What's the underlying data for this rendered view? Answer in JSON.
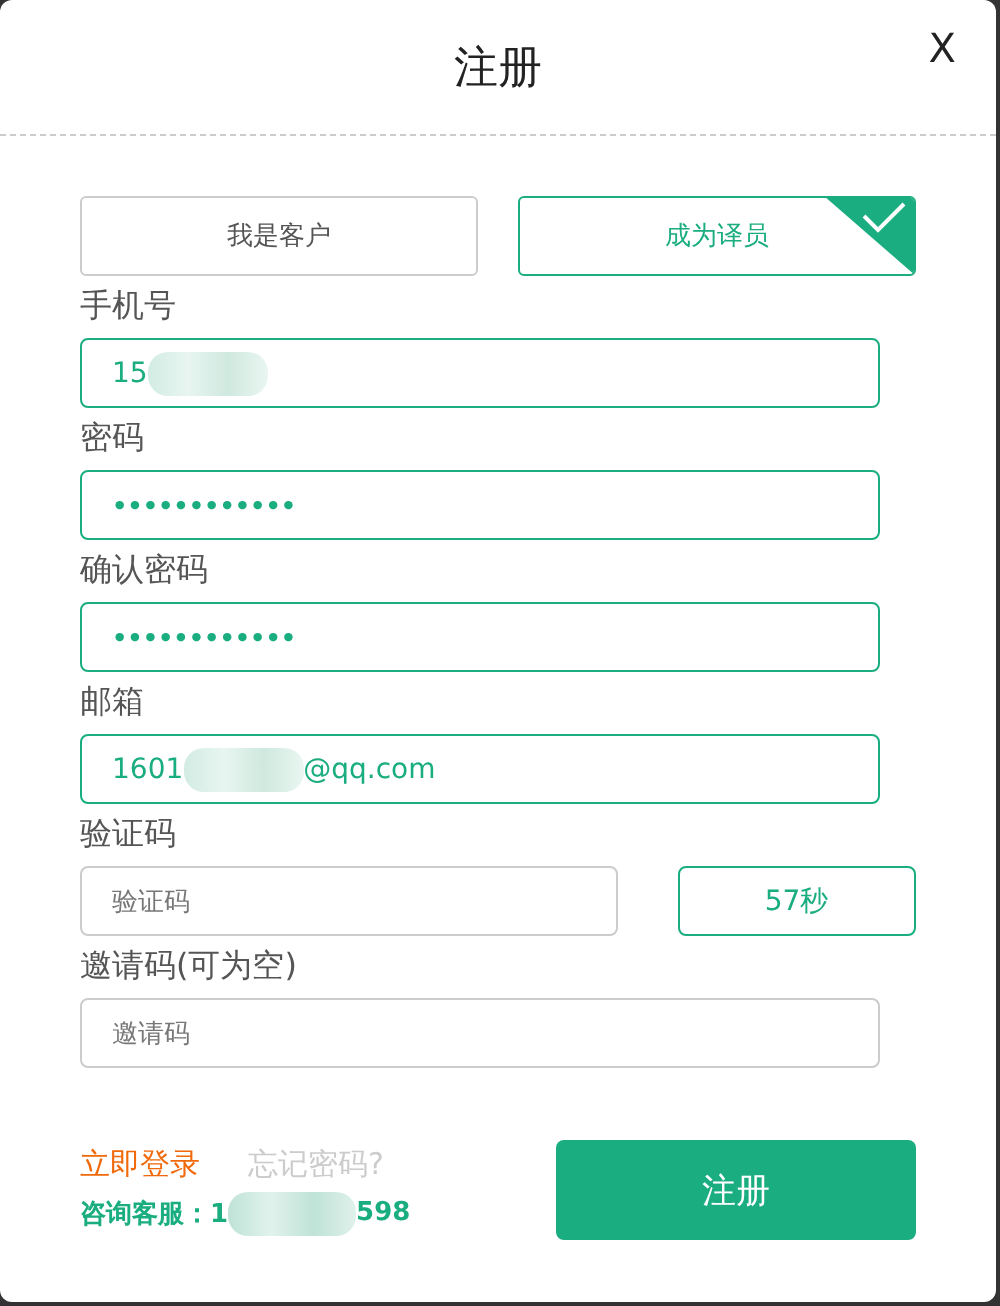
{
  "dialog": {
    "title": "注册",
    "close": "X"
  },
  "roles": [
    {
      "label": "我是客户",
      "selected": false
    },
    {
      "label": "成为译员",
      "selected": true
    }
  ],
  "fields": [
    {
      "label": "手机号",
      "kind": "text",
      "value": "15",
      "redacted": true,
      "highlighted": true
    },
    {
      "label": "密码",
      "kind": "password",
      "value": "••••••••••••",
      "highlighted": true
    },
    {
      "label": "确认密码",
      "kind": "password",
      "value": "••••••••••••",
      "highlighted": true
    },
    {
      "label": "邮箱",
      "kind": "text",
      "value": "1601",
      "redacted": true,
      "suffix": "@qq.com",
      "highlighted": true
    },
    {
      "label": "验证码",
      "kind": "code",
      "placeholder": "验证码",
      "button": "57秒",
      "highlighted": false
    },
    {
      "label": "邀请码(可为空)",
      "kind": "text",
      "placeholder": "邀请码",
      "highlighted": false
    }
  ],
  "footer": {
    "login_link": "立即登录",
    "forgot_link": "忘记密码?",
    "hotline_prefix": "咨询客服：1",
    "hotline_suffix": "598",
    "submit": "注册"
  }
}
